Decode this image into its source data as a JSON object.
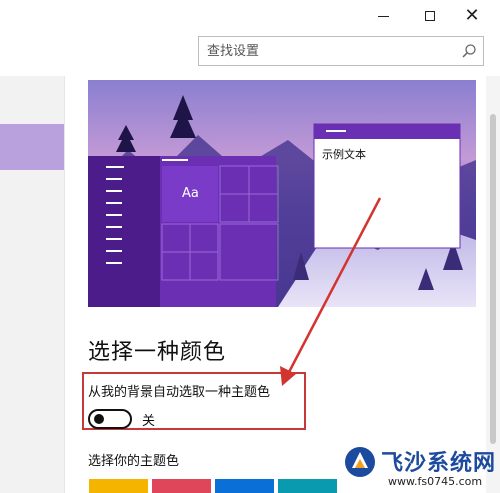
{
  "window": {
    "minimize_glyph": "—",
    "maximize_glyph": "☐",
    "close_glyph": "✕"
  },
  "search": {
    "placeholder": "查找设置",
    "icon": "search-icon"
  },
  "preview": {
    "sample_tile_text": "Aa",
    "sample_window_text": "示例文本",
    "accent_color": "#6a2fb3"
  },
  "color_section": {
    "title": "选择一种颜色",
    "auto_pick_label": "从我的背景自动选取一种主题色",
    "toggle_state_label": "关",
    "toggle_on": false,
    "pick_label": "选择你的主题色",
    "swatches": [
      "#f5b400",
      "#e0465a",
      "#0a6fd6",
      "#0a9ab0"
    ]
  },
  "watermark": {
    "title": "飞沙系统网",
    "url": "www.fs0745.com"
  },
  "colors": {
    "nav_selected": "#b9a1dd",
    "highlight_box": "#c43a3a"
  }
}
